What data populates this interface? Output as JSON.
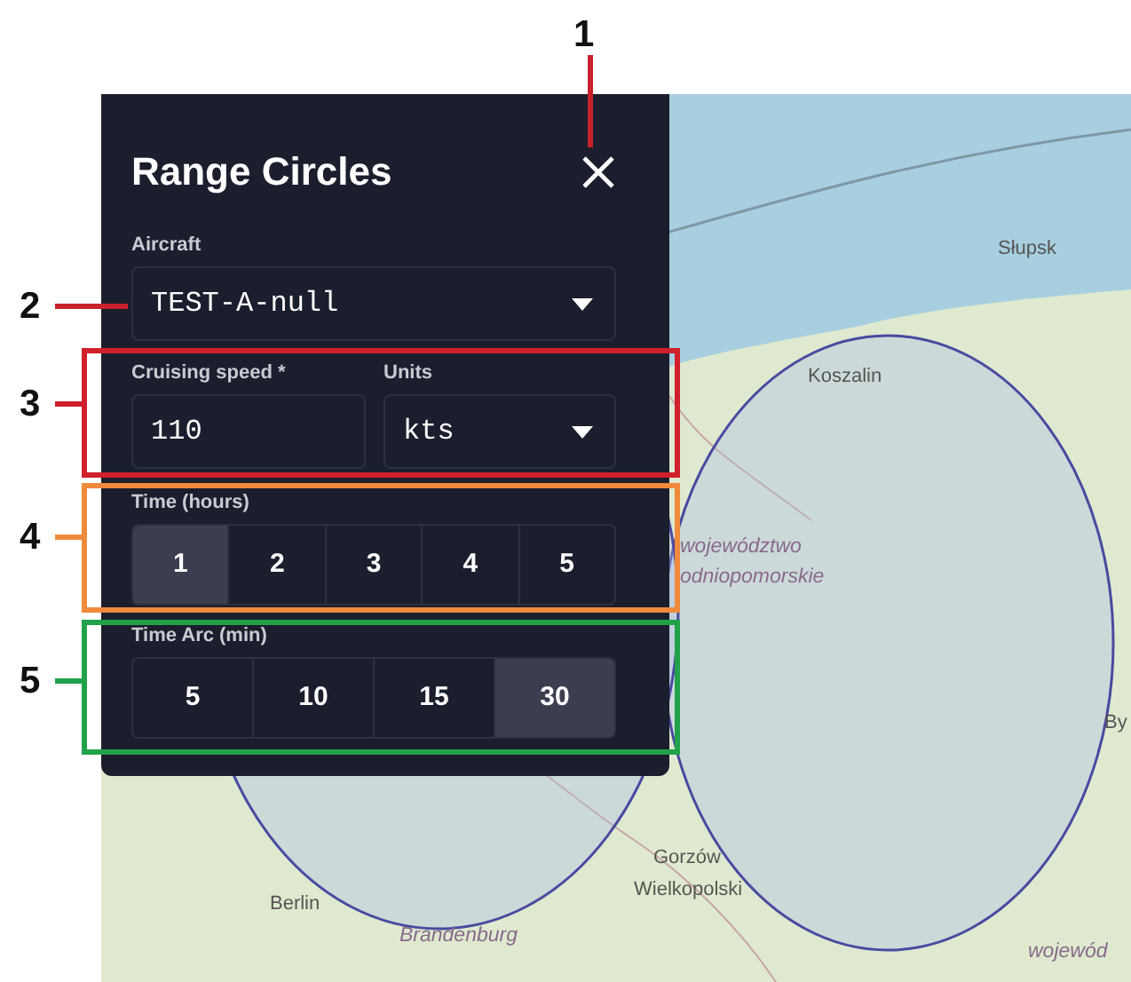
{
  "map": {
    "labels": [
      {
        "text": "Słupsk",
        "kind": "city"
      },
      {
        "text": "Koszalin",
        "kind": "city"
      },
      {
        "text": "województwo",
        "kind": "region"
      },
      {
        "text": "odniopomorskie",
        "kind": "region"
      },
      {
        "text": "Gorzów",
        "kind": "city"
      },
      {
        "text": "Wielkopolski",
        "kind": "city"
      },
      {
        "text": "Berlin",
        "kind": "city"
      },
      {
        "text": "Brandenburg",
        "kind": "region"
      },
      {
        "text": "By",
        "kind": "city"
      },
      {
        "text": "wojewód",
        "kind": "region"
      }
    ]
  },
  "panel": {
    "title": "Range Circles",
    "aircraft": {
      "label": "Aircraft",
      "value": "TEST-A-null"
    },
    "cruising_speed": {
      "label": "Cruising speed *",
      "value": "110"
    },
    "units": {
      "label": "Units",
      "value": "kts"
    },
    "time_hours": {
      "label": "Time (hours)",
      "options": [
        {
          "label": "1",
          "selected": true
        },
        {
          "label": "2",
          "selected": false
        },
        {
          "label": "3",
          "selected": false
        },
        {
          "label": "4",
          "selected": false
        },
        {
          "label": "5",
          "selected": false
        }
      ]
    },
    "time_arc": {
      "label": "Time Arc (min)",
      "options": [
        {
          "label": "5",
          "selected": false
        },
        {
          "label": "10",
          "selected": false
        },
        {
          "label": "15",
          "selected": false
        },
        {
          "label": "30",
          "selected": true
        }
      ]
    }
  },
  "annotations": [
    {
      "number": "1",
      "color": "#c8202c",
      "kind": "pointer"
    },
    {
      "number": "2",
      "color": "#c8202c",
      "kind": "pointer"
    },
    {
      "number": "3",
      "color": "#d0202c",
      "kind": "frame"
    },
    {
      "number": "4",
      "color": "#ef8a3c",
      "kind": "frame"
    },
    {
      "number": "5",
      "color": "#21a24a",
      "kind": "frame"
    }
  ]
}
